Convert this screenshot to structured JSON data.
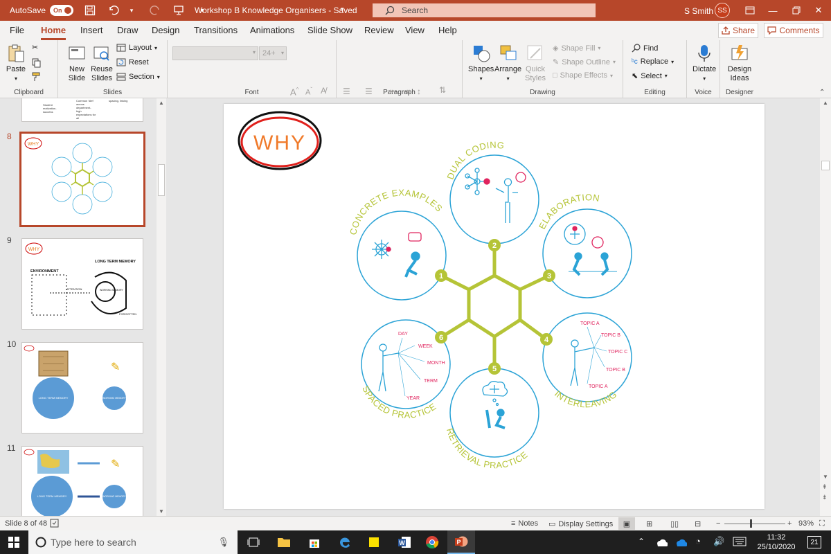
{
  "titlebar": {
    "autosave_label": "AutoSave",
    "autosave_state": "On",
    "doc_title": "Workshop B Knowledge Organisers  -  Saved",
    "search_placeholder": "Search",
    "user_name": "S Smith",
    "user_initials": "SS"
  },
  "tabs": [
    "File",
    "Home",
    "Insert",
    "Draw",
    "Design",
    "Transitions",
    "Animations",
    "Slide Show",
    "Review",
    "View",
    "Help"
  ],
  "share_label": "Share",
  "comments_label": "Comments",
  "ribbon": {
    "clipboard": {
      "paste": "Paste",
      "label": "Clipboard"
    },
    "slides": {
      "new_slide": "New Slide",
      "reuse_slides": "Reuse Slides",
      "layout": "Layout",
      "reset": "Reset",
      "section": "Section",
      "label": "Slides"
    },
    "font": {
      "size": "24+",
      "label": "Font"
    },
    "paragraph": {
      "label": "Paragraph"
    },
    "drawing": {
      "shapes": "Shapes",
      "arrange": "Arrange",
      "quick_styles": "Quick Styles",
      "shape_fill": "Shape Fill",
      "shape_outline": "Shape Outline",
      "shape_effects": "Shape Effects",
      "label": "Drawing"
    },
    "editing": {
      "find": "Find",
      "replace": "Replace",
      "select": "Select",
      "label": "Editing"
    },
    "voice": {
      "dictate": "Dictate",
      "label": "Voice"
    },
    "designer": {
      "design_ideas": "Design Ideas",
      "label": "Designer"
    }
  },
  "thumbnails": {
    "partial_text": [
      "Student motivation- success",
      "Common 'diet' across department- high expectations for all",
      "spacing, linking"
    ],
    "slides": [
      {
        "num": "8",
        "selected": true
      },
      {
        "num": "9",
        "env": "ENVIRONMENT",
        "ltm": "LONG TERM MEMORY",
        "attention": "ATTENTION",
        "wm": "WORKING MEMORY",
        "forgotten": "FORGOTTEN"
      },
      {
        "num": "10",
        "ltm": "LONG TERM MEMORY",
        "wm": "WORKING MEMORY"
      },
      {
        "num": "11",
        "ltm": "LONG TERM MEMORY",
        "wm": "WORKING MEMORY"
      }
    ]
  },
  "slide": {
    "why_label": "WHY",
    "strategies": [
      {
        "n": "1",
        "name": "CONCRETE EXAMPLES"
      },
      {
        "n": "2",
        "name": "DUAL CODING"
      },
      {
        "n": "3",
        "name": "ELABORATION"
      },
      {
        "n": "4",
        "name": "INTERLEAVING"
      },
      {
        "n": "5",
        "name": "RETRIEVAL PRACTICE"
      },
      {
        "n": "6",
        "name": "SPACED PRACTICE"
      }
    ],
    "interleaving_topics": [
      "TOPIC A",
      "TOPIC B",
      "TOPIC C",
      "TOPIC B",
      "TOPIC A"
    ],
    "spaced_labels": [
      "DAY",
      "WEEK",
      "MONTH",
      "TERM",
      "YEAR"
    ]
  },
  "statusbar": {
    "slide_info": "Slide 8 of 48",
    "notes": "Notes",
    "display_settings": "Display Settings",
    "zoom": "93%"
  },
  "taskbar": {
    "search_placeholder": "Type here to search",
    "time": "11:32",
    "date": "25/10/2020",
    "notification_count": "21"
  },
  "colors": {
    "accent": "#b7472a",
    "lime": "#b5c437",
    "blue": "#2ba3d6",
    "pink": "#e0245e"
  }
}
